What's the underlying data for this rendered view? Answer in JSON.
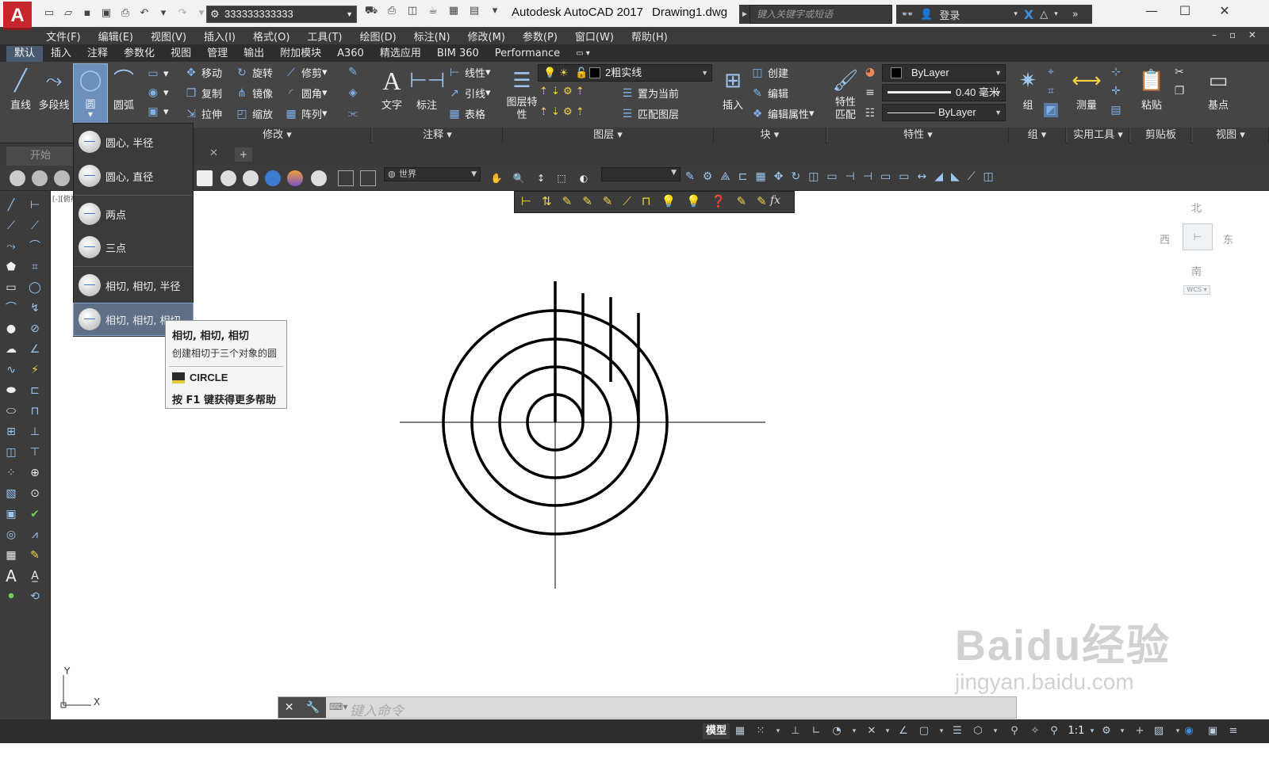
{
  "titlebar": {
    "app_logo": "A",
    "workspace": "333333333333",
    "app_title": "Autodesk AutoCAD 2017",
    "document": "Drawing1.dwg",
    "search_placeholder": "键入关键字或短语",
    "login": "登录"
  },
  "menubar": {
    "items": [
      "文件(F)",
      "编辑(E)",
      "视图(V)",
      "插入(I)",
      "格式(O)",
      "工具(T)",
      "绘图(D)",
      "标注(N)",
      "修改(M)",
      "参数(P)",
      "窗口(W)",
      "帮助(H)"
    ]
  },
  "ribbon_tabs": [
    "默认",
    "插入",
    "注释",
    "参数化",
    "视图",
    "管理",
    "输出",
    "附加模块",
    "A360",
    "精选应用",
    "BIM 360",
    "Performance"
  ],
  "ribbon": {
    "draw": {
      "line": "直线",
      "polyline": "多段线",
      "circle": "圆",
      "arc": "圆弧"
    },
    "modify": {
      "move": "移动",
      "rotate": "旋转",
      "trim": "修剪",
      "copy": "复制",
      "mirror": "镜像",
      "fillet": "圆角",
      "stretch": "拉伸",
      "scale": "缩放",
      "array": "阵列",
      "footer": "修改"
    },
    "annotation": {
      "text": "文字",
      "dimension": "标注",
      "linear": "线性",
      "leader": "引线",
      "table": "表格",
      "footer": "注释"
    },
    "layers": {
      "layer_props": "图层特性",
      "layer_name": "2粗实线",
      "set_current": "置为当前",
      "match_layer": "匹配图层",
      "footer": "图层"
    },
    "block": {
      "insert": "插入",
      "create": "创建",
      "edit": "编辑",
      "edit_attr": "编辑属性",
      "footer": "块"
    },
    "properties": {
      "match": "特性匹配",
      "color": "ByLayer",
      "lineweight": "0.40 毫米",
      "linetype": "ByLayer",
      "footer": "特性"
    },
    "groups": {
      "group": "组",
      "footer": "组"
    },
    "utilities": {
      "measure": "测量",
      "footer": "实用工具"
    },
    "clipboard": {
      "paste": "粘贴",
      "footer": "剪贴板"
    },
    "view": {
      "base": "基点",
      "footer": "视图"
    }
  },
  "filetabs": {
    "start": "开始"
  },
  "view_combo": "世界",
  "canvas": {
    "viewport_label": "[-][俯视]"
  },
  "viewcube": {
    "north": "北",
    "south": "南",
    "east": "东",
    "west": "西",
    "wcs": "WCS"
  },
  "ucs": {
    "x": "X",
    "y": "Y"
  },
  "circle_dropdown": {
    "items": [
      "圆心, 半径",
      "圆心, 直径",
      "两点",
      "三点",
      "相切, 相切, 半径",
      "相切, 相切, 相切"
    ],
    "highlighted_index": 5
  },
  "tooltip": {
    "title": "相切, 相切, 相切",
    "description": "创建相切于三个对象的圆",
    "command": "CIRCLE",
    "help": "按 F1 键获得更多帮助"
  },
  "command_line": {
    "placeholder": "键入命令"
  },
  "statusbar": {
    "model": "模型",
    "scale": "1:1"
  },
  "watermark": {
    "brand": "Baidu经验",
    "url": "jingyan.baidu.com"
  }
}
